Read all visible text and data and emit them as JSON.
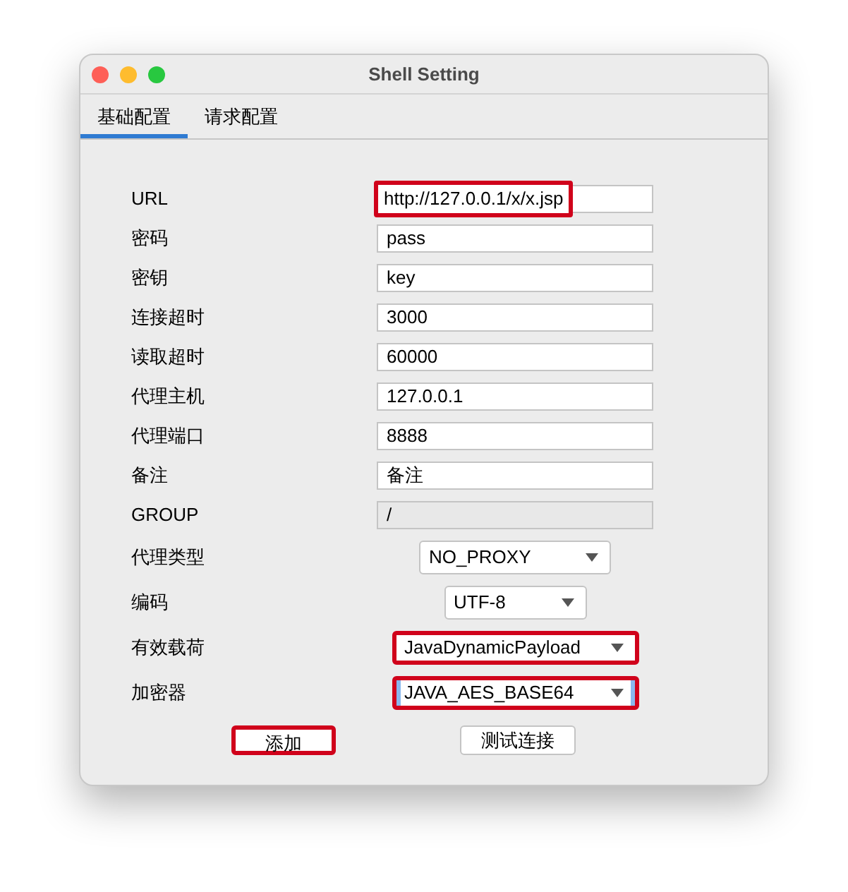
{
  "window": {
    "title": "Shell Setting"
  },
  "tabs": [
    {
      "label": "基础配置",
      "selected": true
    },
    {
      "label": "请求配置",
      "selected": false
    }
  ],
  "fields": [
    {
      "kind": "text",
      "label": "URL",
      "value": "http://127.0.0.1/x/x.jsp",
      "highlighted": true,
      "disabled": false
    },
    {
      "kind": "text",
      "label": "密码",
      "value": "pass",
      "highlighted": false,
      "disabled": false
    },
    {
      "kind": "text",
      "label": "密钥",
      "value": "key",
      "highlighted": false,
      "disabled": false
    },
    {
      "kind": "text",
      "label": "连接超时",
      "value": "3000",
      "highlighted": false,
      "disabled": false
    },
    {
      "kind": "text",
      "label": "读取超时",
      "value": "60000",
      "highlighted": false,
      "disabled": false
    },
    {
      "kind": "text",
      "label": "代理主机",
      "value": "127.0.0.1",
      "highlighted": false,
      "disabled": false
    },
    {
      "kind": "text",
      "label": "代理端口",
      "value": "8888",
      "highlighted": false,
      "disabled": false
    },
    {
      "kind": "text",
      "label": "备注",
      "value": "备注",
      "highlighted": false,
      "disabled": false
    },
    {
      "kind": "text",
      "label": "GROUP",
      "value": "/",
      "highlighted": false,
      "disabled": true
    },
    {
      "kind": "select",
      "label": "代理类型",
      "value": "NO_PROXY",
      "highlighted": false,
      "focused": false
    },
    {
      "kind": "select",
      "label": "编码",
      "value": "UTF-8",
      "highlighted": false,
      "focused": false
    },
    {
      "kind": "select",
      "label": "有效载荷",
      "value": "JavaDynamicPayload",
      "highlighted": true,
      "focused": false
    },
    {
      "kind": "select",
      "label": "加密器",
      "value": "JAVA_AES_BASE64",
      "highlighted": true,
      "focused": true
    }
  ],
  "buttons": [
    {
      "label": "添加",
      "highlighted": true
    },
    {
      "label": "测试连接",
      "highlighted": false
    }
  ]
}
